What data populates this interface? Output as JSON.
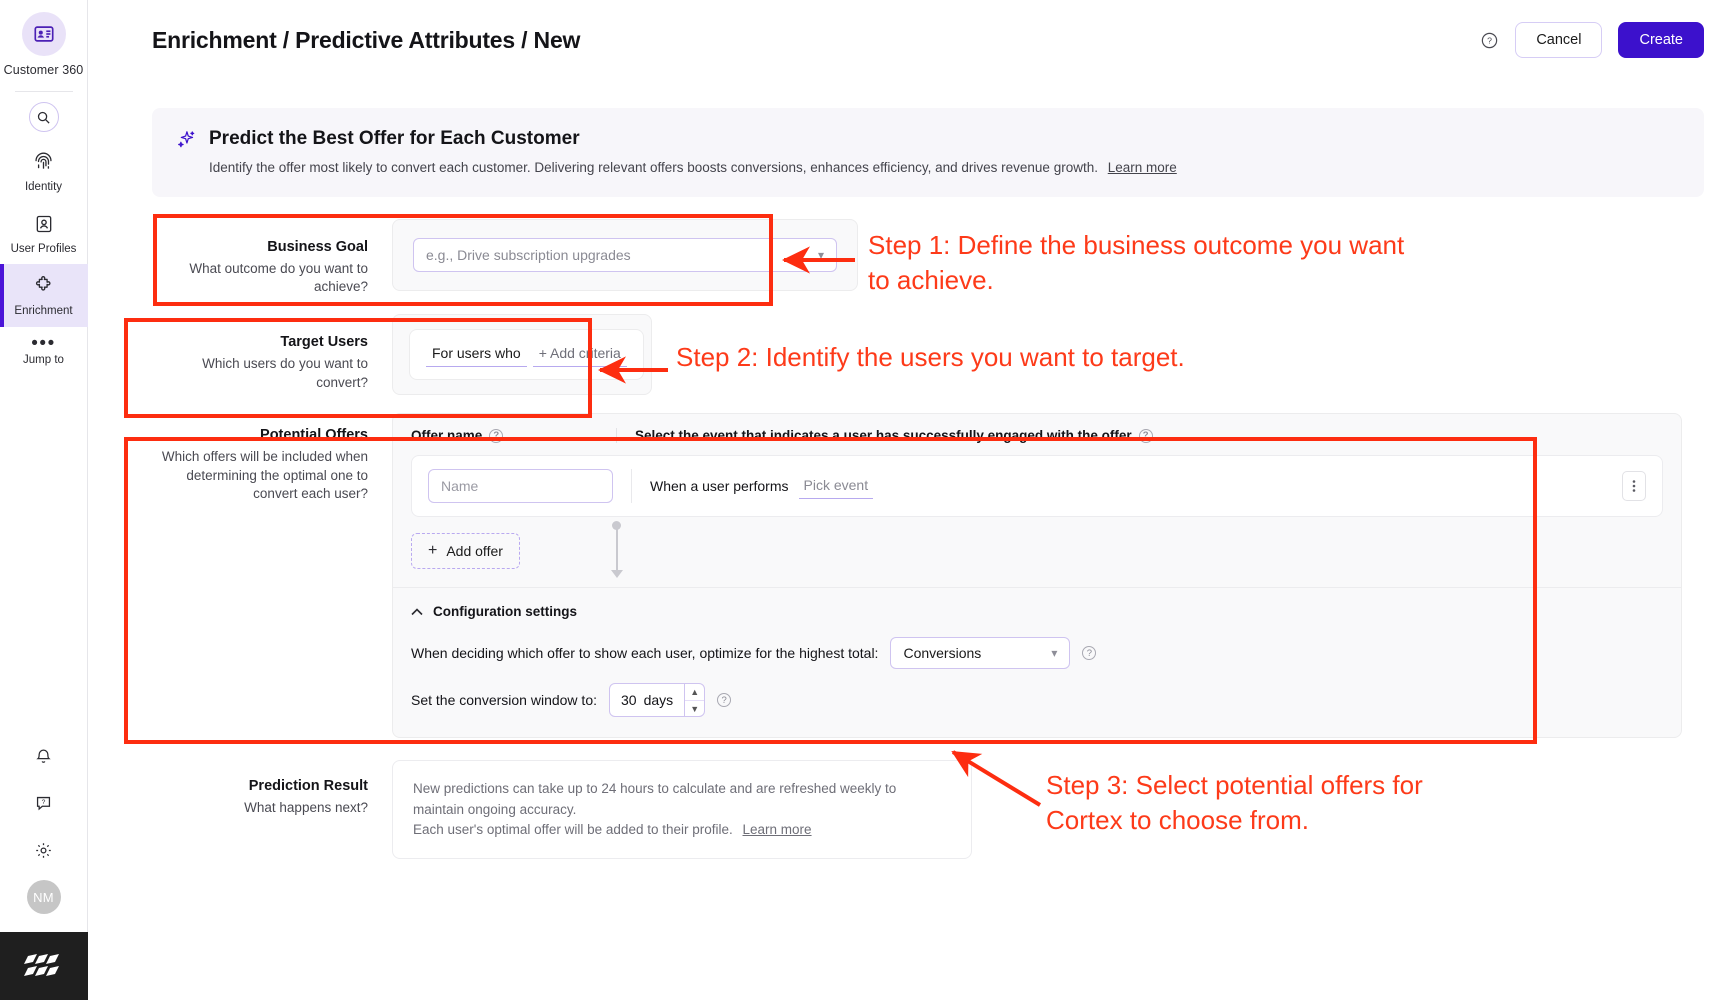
{
  "rail": {
    "brand": {
      "label": "Customer 360",
      "icon": "contact-card-icon"
    },
    "search": {
      "icon": "search-icon"
    },
    "items": [
      {
        "label": "Identity",
        "icon": "fingerprint-icon",
        "active": false
      },
      {
        "label": "User Profiles",
        "icon": "user-profile-icon",
        "active": false
      },
      {
        "label": "Enrichment",
        "icon": "puzzle-piece-icon",
        "active": true
      },
      {
        "label": "Jump to",
        "icon": "ellipsis-icon",
        "active": false
      }
    ],
    "bottom": {
      "notifications_icon": "bell-icon",
      "help_icon": "question-chat-icon",
      "settings_icon": "gear-icon",
      "avatar_initials": "NM",
      "logo_icon": "amplitude-logo-icon"
    }
  },
  "header": {
    "title": "Enrichment / Predictive Attributes / New",
    "help_icon": "question-mark-circle-icon",
    "cancel_label": "Cancel",
    "create_label": "Create"
  },
  "banner": {
    "icon": "sparkle-icon",
    "title": "Predict the Best Offer for Each Customer",
    "subtitle": "Identify the offer most likely to convert each customer. Delivering relevant offers boosts conversions, enhances efficiency, and drives revenue growth.",
    "link": "Learn more"
  },
  "business_goal": {
    "title": "Business Goal",
    "description": "What outcome do you want to achieve?",
    "select_placeholder": "e.g., Drive subscription upgrades",
    "select_value": "",
    "chevron": "chevron-down-icon"
  },
  "target_users": {
    "title": "Target Users",
    "description": "Which users do you want to convert?",
    "for_users_who": "For users who",
    "add_criteria": "+ Add criteria"
  },
  "potential_offers": {
    "title": "Potential Offers",
    "description": "Which offers will be included when determining the optimal one to convert each user?",
    "col_offer_name": "Offer name",
    "col_event": "Select the event that indicates a user has successfully engaged with the offer",
    "name_placeholder": "Name",
    "name_value": "",
    "when_user_performs": "When a user performs",
    "pick_event": "Pick event",
    "kebab_icon": "kebab-menu-icon",
    "add_offer": "Add offer",
    "config": {
      "toggle_icon": "chevron-up-icon",
      "title": "Configuration settings",
      "optimize_label": "When deciding which offer to show each user, optimize for the highest total:",
      "optimize_value": "Conversions",
      "window_label": "Set the conversion window to:",
      "window_value": "30",
      "window_unit": "days"
    }
  },
  "prediction_result": {
    "title": "Prediction Result",
    "description": "What happens next?",
    "body_line1": "New predictions can take up to 24 hours to calculate and are refreshed weekly to maintain ongoing accuracy.",
    "body_line2": "Each user's optimal offer will be added to their profile.",
    "link": "Learn more"
  },
  "annotations": {
    "accent_color": "#fd2d10",
    "step1": "Step 1: Define the business outcome you want to achieve.",
    "step2": "Step 2: Identify the users you want to target.",
    "step3": "Step 3: Select potential offers for Cortex to choose from."
  }
}
